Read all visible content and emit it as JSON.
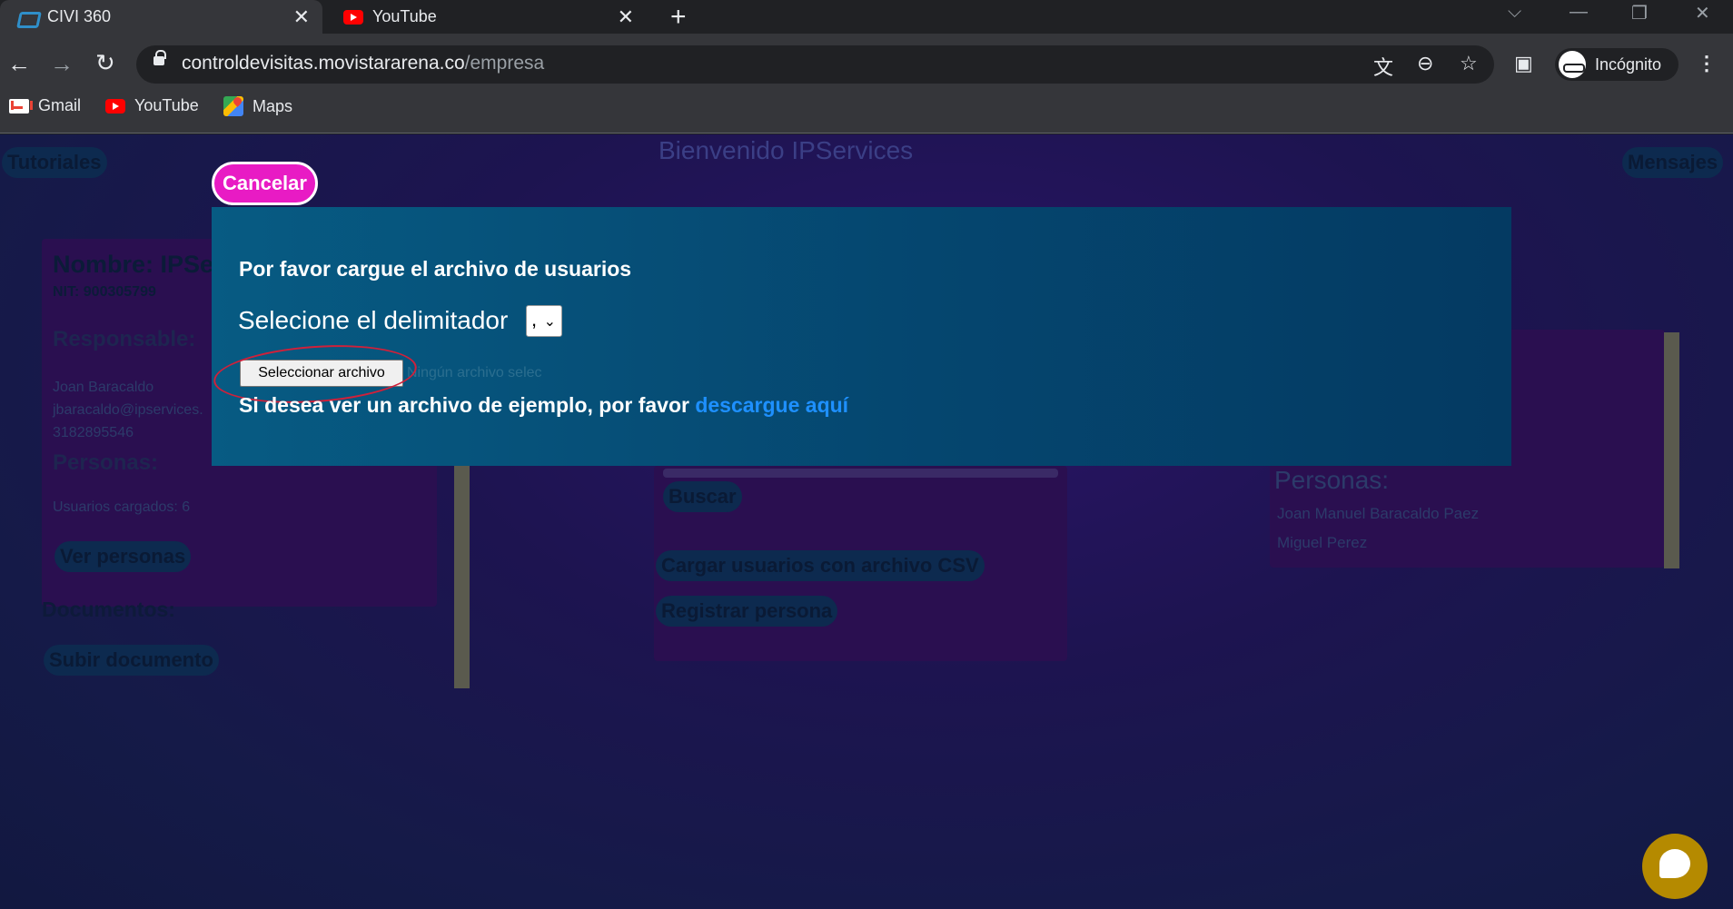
{
  "browser": {
    "tabs": [
      {
        "title": "CIVI 360",
        "active": true
      },
      {
        "title": "YouTube",
        "active": false
      }
    ],
    "url_host": "controldevisitas.movistararena.co",
    "url_path": "/empresa",
    "profile_label": "Incógnito",
    "bookmarks": [
      "Gmail",
      "YouTube",
      "Maps"
    ]
  },
  "page": {
    "welcome": "Bienvenido IPServices",
    "tutorials": "Tutoriales",
    "messages": "Mensajes",
    "left_card": {
      "name": "Nombre: IPSer",
      "nit": "NIT: 900305799",
      "responsible_label": "Responsable:",
      "responsible_name": "Joan Baracaldo",
      "responsible_email": "jbaracaldo@ipservices.",
      "responsible_phone": "3182895546",
      "persons_label": "Personas:",
      "users_loaded": "Usuarios cargados: 6",
      "view_persons": "Ver personas",
      "documents_label": "Documentos:",
      "upload_document": "Subir documento"
    },
    "center": {
      "search": "Buscar",
      "upload_csv": "Cargar usuarios con archivo CSV",
      "register_person": "Registrar persona"
    },
    "right_card": {
      "persons_label": "Personas:",
      "persons": [
        "Joan Manuel Baracaldo Paez",
        "Miguel Perez"
      ]
    }
  },
  "modal": {
    "cancel": "Cancelar",
    "title": "Por favor cargue el archivo de usuarios",
    "delimiter_label": "Selecione el delimitador",
    "delimiter_value": ",",
    "file_button": "Seleccionar archivo",
    "file_status": "Ningún archivo selec",
    "sample_text": "Si desea ver un archivo de ejemplo, por favor",
    "sample_link": "descargue aquí"
  },
  "colors": {
    "accent_pink": "#e81bc4",
    "modal_bg": "#05466f",
    "link_blue": "#1e90ff",
    "annotation_red": "#d0203a",
    "chat_gold": "#b58a00"
  }
}
